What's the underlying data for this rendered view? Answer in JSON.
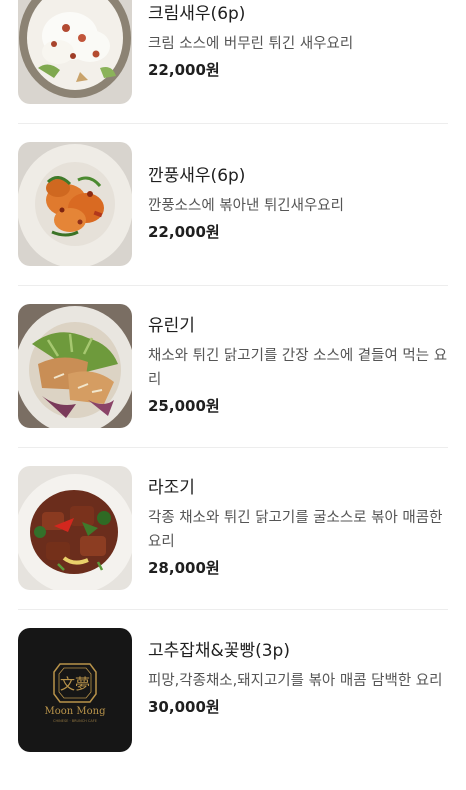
{
  "menu": {
    "items": [
      {
        "name": "크림새우(6p)",
        "description": "크림 소스에 버무린 튀긴 새우요리",
        "price": "22,000원",
        "image": "fried-shrimp-cream-sauce-photo"
      },
      {
        "name": "깐풍새우(6p)",
        "description": "깐풍소스에 볶아낸 튀긴새우요리",
        "price": "22,000원",
        "image": "kkanpung-shrimp-photo"
      },
      {
        "name": "유린기",
        "description": "채소와 튀긴 닭고기를 간장 소스에 곁들여 먹는 요리",
        "price": "25,000원",
        "image": "yurinji-chicken-salad-photo"
      },
      {
        "name": "라조기",
        "description": "각종 채소와 튀긴 닭고기를 굴소스로 볶아 매콤한 요리",
        "price": "28,000원",
        "image": "lajogi-spicy-chicken-photo"
      },
      {
        "name": "고추잡채&꽃빵(3p)",
        "description": "피망,각종채소,돼지고기를 볶아 매콤 담백한 요리",
        "price": "30,000원",
        "image": "moon-mong-logo-placeholder",
        "logo_text": "Moon Mong",
        "logo_subtext": "CHINESE · BRUNCH CAFE",
        "logo_chars": "文夢"
      }
    ]
  },
  "colors": {
    "text_primary": "#1f1f1f",
    "text_secondary": "#555555",
    "divider": "#ededed",
    "logo_bg": "#161616",
    "logo_gold": "#b8934a"
  }
}
